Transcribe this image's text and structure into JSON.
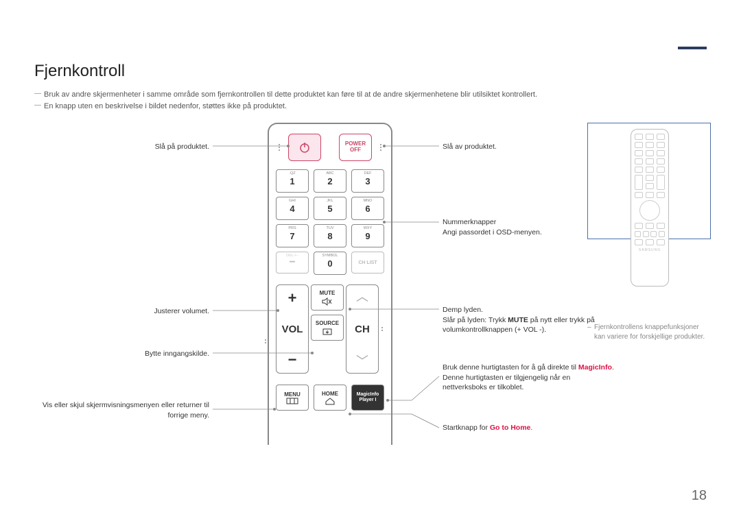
{
  "title": "Fjernkontroll",
  "notes": {
    "n1": "Bruk av andre skjermenheter i samme område som fjernkontrollen til dette produktet kan føre til at de andre skjermenhetene blir utilsiktet kontrollert.",
    "n2": "En knapp uten en beskrivelse i bildet nedenfor, støttes ikke på produktet."
  },
  "remote": {
    "power_off_line1": "POWER",
    "power_off_line2": "OFF",
    "keypad_labels": {
      "k1": ".QZ",
      "k2": "ABC",
      "k3": "DEF",
      "k4": "GHI",
      "k5": "JKL",
      "k6": "MNO",
      "k7": "PRS",
      "k8": "TUV",
      "k9": "WXY",
      "kdel": "DEL-/--",
      "ksym": "SYMBOL"
    },
    "chlist": "CH LIST",
    "vol": "VOL",
    "ch": "CH",
    "mute": "MUTE",
    "source": "SOURCE",
    "menu": "MENU",
    "home": "HOME",
    "magic1": "MagicInfo",
    "magic2": "Player I"
  },
  "left": {
    "power_on": "Slå på produktet.",
    "volume": "Justerer volumet.",
    "source": "Bytte inngangskilde.",
    "menu": "Vis eller skjul skjermvisningsmenyen eller returner til forrige meny."
  },
  "right": {
    "power_off": "Slå av produktet.",
    "numbers_l1": "Nummerknapper",
    "numbers_l2": "Angi passordet i OSD-menyen.",
    "mute_l1": "Demp lyden.",
    "mute_l2a": "Slår på lyden: Trykk ",
    "mute_l2_bold": "MUTE",
    "mute_l2b": " på nytt eller trykk på volumkontrollknappen (+ VOL -).",
    "magic_l1": "Bruk denne hurtigtasten for å gå direkte til ",
    "magic_hl": "MagicInfo",
    "magic_l2": ". Denne hurtigtasten er tilgjengelig når en nettverksboks er tilkoblet.",
    "home_l1": "Startknapp for ",
    "home_hl": "Go to Home",
    "home_l2": "."
  },
  "side_note": "Fjernkontrollens knappefunksjoner kan variere for forskjellige produkter.",
  "page": "18"
}
